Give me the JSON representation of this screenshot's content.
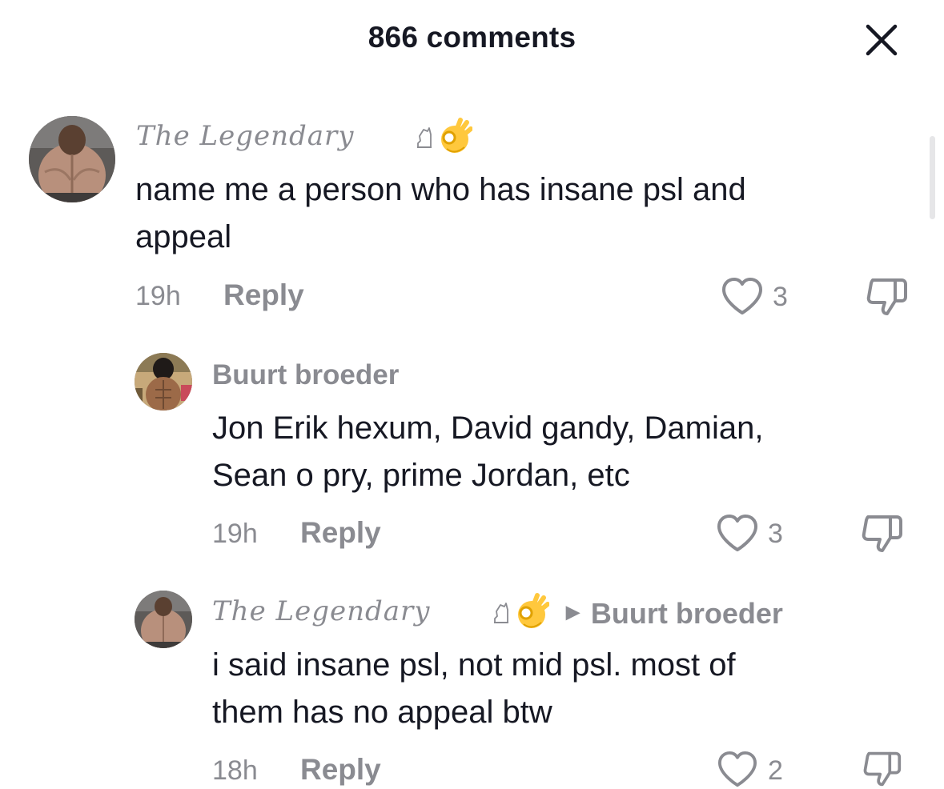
{
  "header": {
    "title": "866 comments"
  },
  "comments": [
    {
      "username": "The Legendary",
      "text_lines": [
        "name me a person who has insane psl and",
        "appeal"
      ],
      "time": "19h",
      "reply_label": "Reply",
      "likes": "3",
      "badge_icons": [
        "chess-knight-icon",
        "ok-hand-emoji"
      ]
    },
    {
      "username": "Buurt broeder",
      "text_lines": [
        "Jon Erik hexum, David gandy, Damian,",
        "Sean o pry, prime Jordan, etc"
      ],
      "time": "19h",
      "reply_label": "Reply",
      "likes": "3"
    },
    {
      "username": "The Legendary",
      "reply_to": "Buurt broeder",
      "text_lines": [
        "i said insane psl, not mid psl. most of",
        "them has no appeal btw"
      ],
      "time": "18h",
      "reply_label": "Reply",
      "likes": "2",
      "badge_icons": [
        "chess-knight-icon",
        "ok-hand-emoji"
      ]
    }
  ],
  "colors": {
    "text_primary": "#161823",
    "text_secondary": "#8a8b91",
    "emoji_yellow": "#ffc83d"
  }
}
